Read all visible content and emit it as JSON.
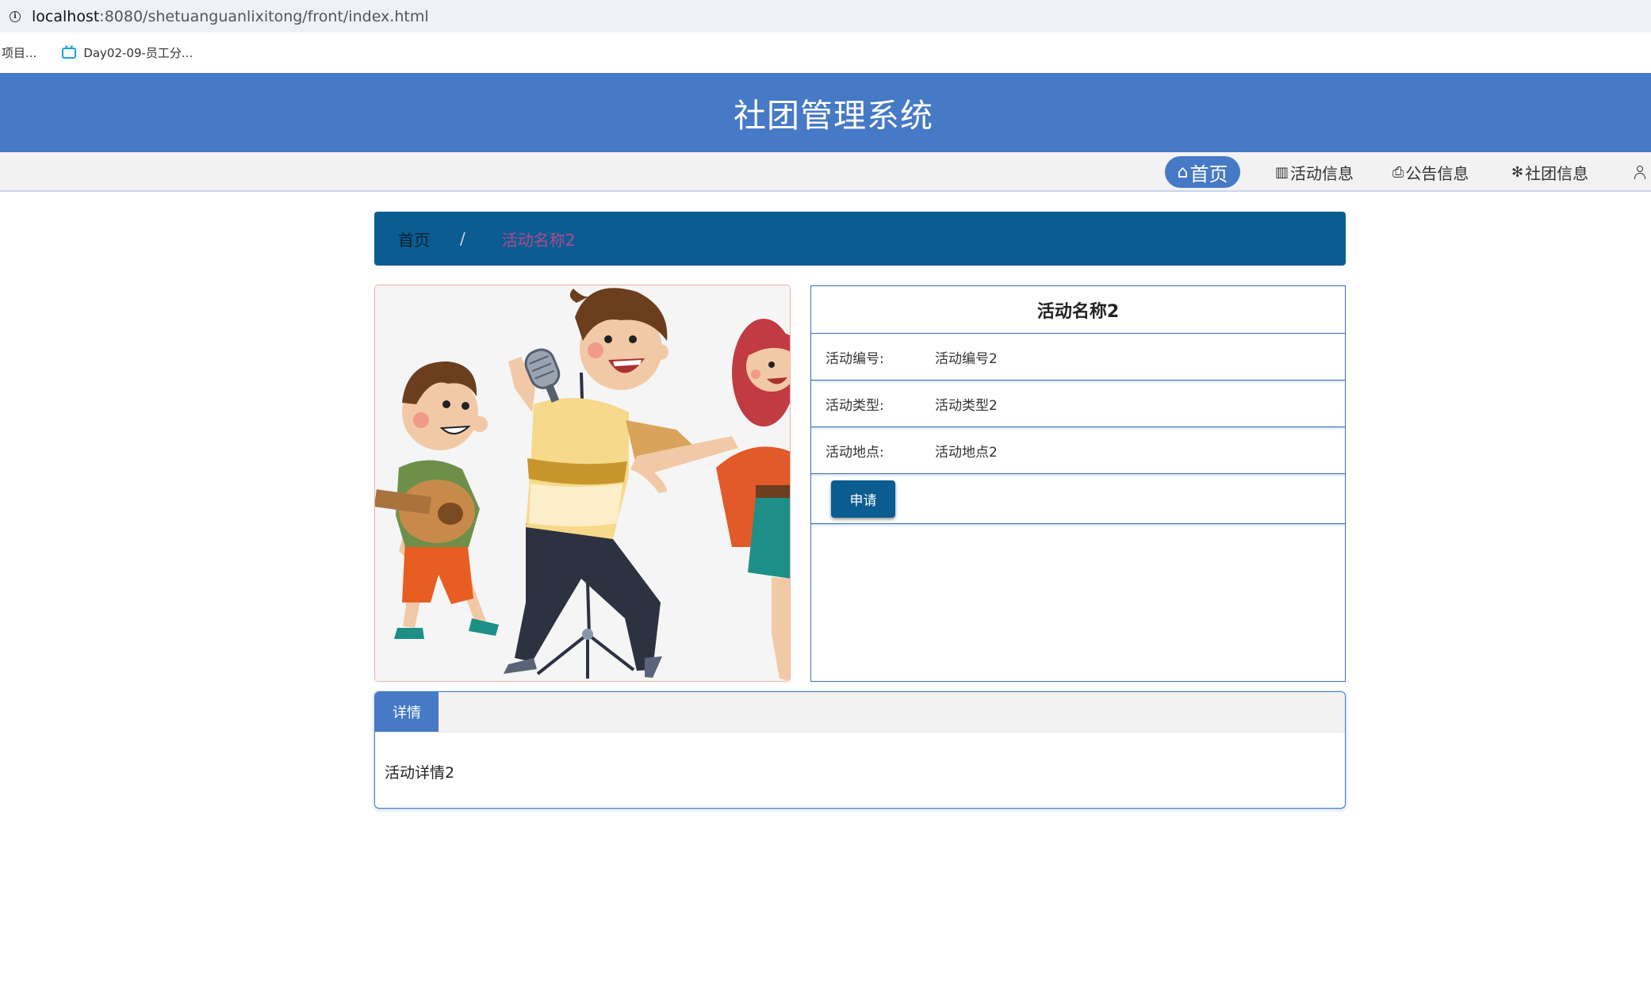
{
  "browser": {
    "url_host": "localhost",
    "url_rest": ":8080/shetuanguanlixitong/front/index.html",
    "bookmarks": [
      {
        "label": "项目..."
      },
      {
        "label": "Day02-09-员工分..."
      }
    ]
  },
  "header": {
    "title": "社团管理系统"
  },
  "nav": {
    "items": [
      {
        "icon": "home-icon",
        "glyph": "⌂",
        "label": "首页"
      },
      {
        "icon": "grid-icon",
        "glyph": "▥",
        "label": "活动信息"
      },
      {
        "icon": "printer-icon",
        "glyph": "⎙",
        "label": "公告信息"
      },
      {
        "icon": "snowflake-icon",
        "glyph": "✻",
        "label": "社团信息"
      },
      {
        "icon": "user-icon",
        "label": ""
      }
    ]
  },
  "breadcrumb": {
    "home": "首页",
    "separator": "/",
    "current": "活动名称2"
  },
  "activity": {
    "name": "活动名称2",
    "fields": [
      {
        "label": "活动编号:",
        "value": "活动编号2"
      },
      {
        "label": "活动类型:",
        "value": "活动类型2"
      },
      {
        "label": "活动地点:",
        "value": "活动地点2"
      }
    ],
    "apply_label": "申请"
  },
  "details": {
    "tab_label": "详情",
    "content": "活动详情2"
  },
  "colors": {
    "header_bg": "#4679c6",
    "breadcrumb_bg": "#0a5c91",
    "button_bg": "#0a5c91",
    "breadcrumb_current": "#b14a8e"
  }
}
